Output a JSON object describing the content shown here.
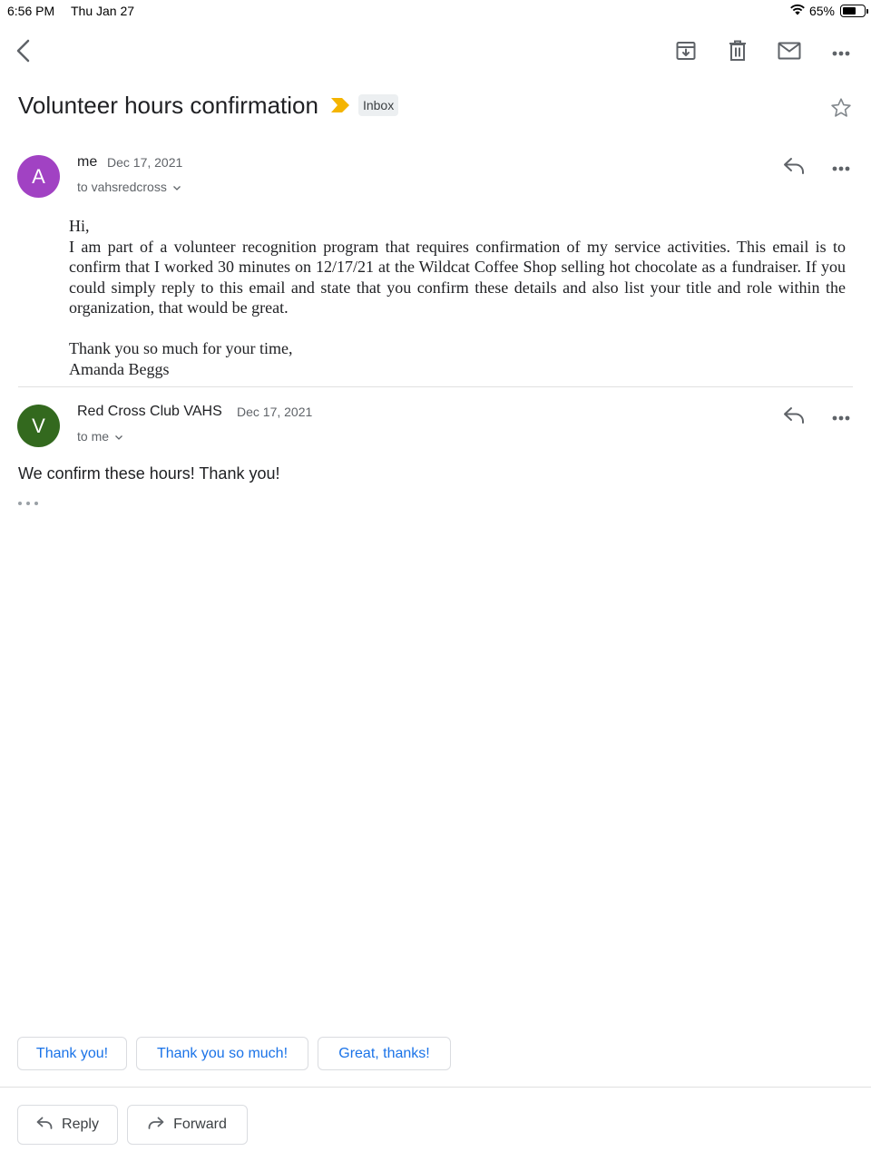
{
  "status_bar": {
    "time": "6:56 PM",
    "date": "Thu Jan 27",
    "battery": "65%",
    "battery_level": 0.65
  },
  "toolbar": {
    "back_icon": "chevron-left-icon",
    "archive_icon": "archive-icon",
    "delete_icon": "trash-icon",
    "mark_unread_icon": "mail-icon",
    "more_icon": "more-horizontal-icon"
  },
  "thread": {
    "subject": "Volunteer hours confirmation",
    "label": "Inbox",
    "importance_color": "#f4b400",
    "star_icon": "star-outline-icon"
  },
  "messages": [
    {
      "avatar_letter": "A",
      "avatar_color": "#a142c3",
      "sender": "me",
      "date": "Dec 17, 2021",
      "recipient": "to vahsredcross",
      "body_lines": {
        "greeting": "Hi,",
        "paragraph": "I am part of a volunteer recognition program that requires confirmation of my service activities. This email is to confirm that I worked 30 minutes on 12/17/21 at the Wildcat Coffee Shop selling hot chocolate as a fundraiser. If you could simply reply to this email and state that you confirm these details and also list your title and role within the organization, that would be great.",
        "signoff": "Thank you so much for your time,",
        "signature": "Amanda Beggs"
      }
    },
    {
      "avatar_letter": "V",
      "avatar_color": "#33691e",
      "sender": "Red Cross Club VAHS",
      "date": "Dec 17, 2021",
      "recipient": "to me",
      "body": "We confirm these hours! Thank you!"
    }
  ],
  "smart_replies": [
    "Thank you!",
    "Thank you so much!",
    "Great, thanks!"
  ],
  "actions": {
    "reply": "Reply",
    "forward": "Forward"
  },
  "colors": {
    "link_blue": "#1a73e8",
    "label_bg": "#eceff1"
  }
}
